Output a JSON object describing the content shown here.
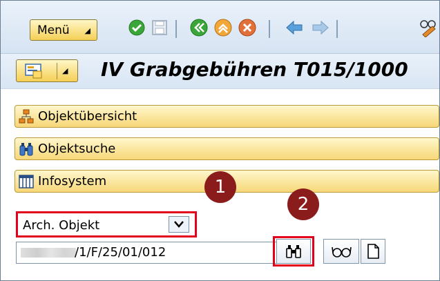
{
  "toolbar": {
    "menu_label": "Menü",
    "icons": [
      "check-icon",
      "save-icon",
      "back-icon",
      "exit-icon",
      "cancel-icon",
      "arrow-left-icon",
      "arrow-right-icon",
      "glasses-icon"
    ]
  },
  "titlebar": {
    "title": "IV Grabgebühren T015/1000"
  },
  "nav": {
    "items": [
      {
        "label": "Objektübersicht",
        "icon": "hierarchy-icon"
      },
      {
        "label": "Objektsuche",
        "icon": "binoculars-icon"
      },
      {
        "label": "Infosystem",
        "icon": "table-icon"
      }
    ]
  },
  "search": {
    "select_value": "Arch. Objekt",
    "input_value": "/1/F/25/01/012"
  },
  "badges": [
    "1",
    "2"
  ],
  "colors": {
    "accent_yellow": "#f5cf55",
    "highlight_red": "#e3001b",
    "badge": "#8b1c1c",
    "toolbar_bg": "#d6e3f2"
  }
}
